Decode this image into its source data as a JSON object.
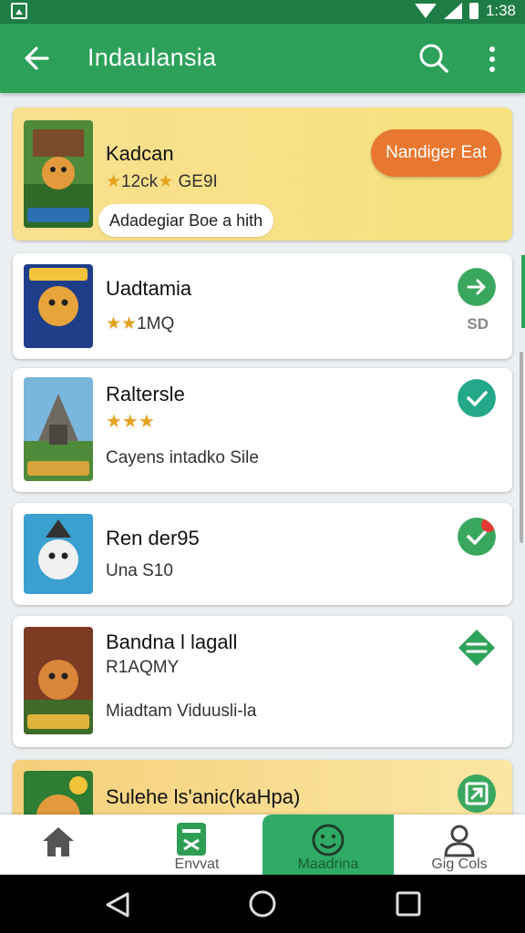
{
  "status_bar": {
    "time": "1:38"
  },
  "app_bar": {
    "title": "Indaulansia",
    "back_icon": "arrow-left-icon",
    "search_icon": "search-icon",
    "more_icon": "more-vert-icon"
  },
  "list": [
    {
      "name": "Kadcan",
      "rating_text": "12ck",
      "size": "GE9I",
      "action_label": "Nandiger Eat",
      "chip": "Adadegiar Boe a hith"
    },
    {
      "name": "Uadtamia",
      "rating_text": "1MQ",
      "badge": "SD"
    },
    {
      "name": "Raltersle",
      "desc": "Cayens intadko Sile"
    },
    {
      "name": "Ren der95",
      "sub": "Una S10"
    },
    {
      "name": "Bandna l lagall",
      "sub": "R1AQMY",
      "desc": "Miadtam Viduusli-la"
    },
    {
      "name": "Sulehe ls'anic(kaHpa)"
    }
  ],
  "bottom_nav": [
    {
      "label": "",
      "icon": "home-icon"
    },
    {
      "label": "Envvat",
      "icon": "grid-app-icon"
    },
    {
      "label": "Maadrina",
      "icon": "smiley-icon",
      "active": true
    },
    {
      "label": "Gig Cols",
      "icon": "person-icon"
    }
  ],
  "colors": {
    "primary": "#2da15a",
    "primary_dark": "#1e7d45",
    "accent": "#e8772f",
    "featured_bg": "#f8e08f"
  }
}
